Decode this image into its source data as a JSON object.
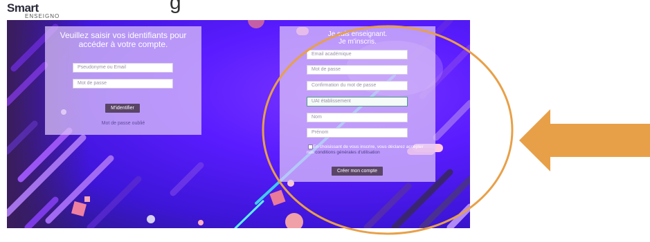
{
  "brand": {
    "name": "Smart",
    "sub": "ENSEIGNO"
  },
  "top_text": "g",
  "login": {
    "title": "Veuillez saisir vos identifiants pour accéder à votre compte.",
    "username_placeholder": "Pseudonyme ou Email",
    "password_placeholder": "Mot de passe",
    "submit_label": "M'identifier",
    "forgot_link": "Mot de passe oublié"
  },
  "signup": {
    "title_line1": "Je suis enseignant.",
    "title_line2": "Je m'inscris.",
    "email_placeholder": "Email académique",
    "password_placeholder": "Mot de passe",
    "confirm_placeholder": "Confirmation du mot de passe",
    "uai_placeholder": "UAI établissement",
    "lastname_placeholder": "Nom",
    "firstname_placeholder": "Prénom",
    "consent_text": "En choisissant de vous inscrire, vous déclarez accepter nos",
    "consent_link": "conditions générales d'utilisation",
    "submit_label": "Créer mon compte"
  },
  "colors": {
    "accent_purple": "#5a1cff",
    "panel": "#e0c8fa",
    "button": "#5a4566",
    "annotation_orange": "#e8a048"
  }
}
